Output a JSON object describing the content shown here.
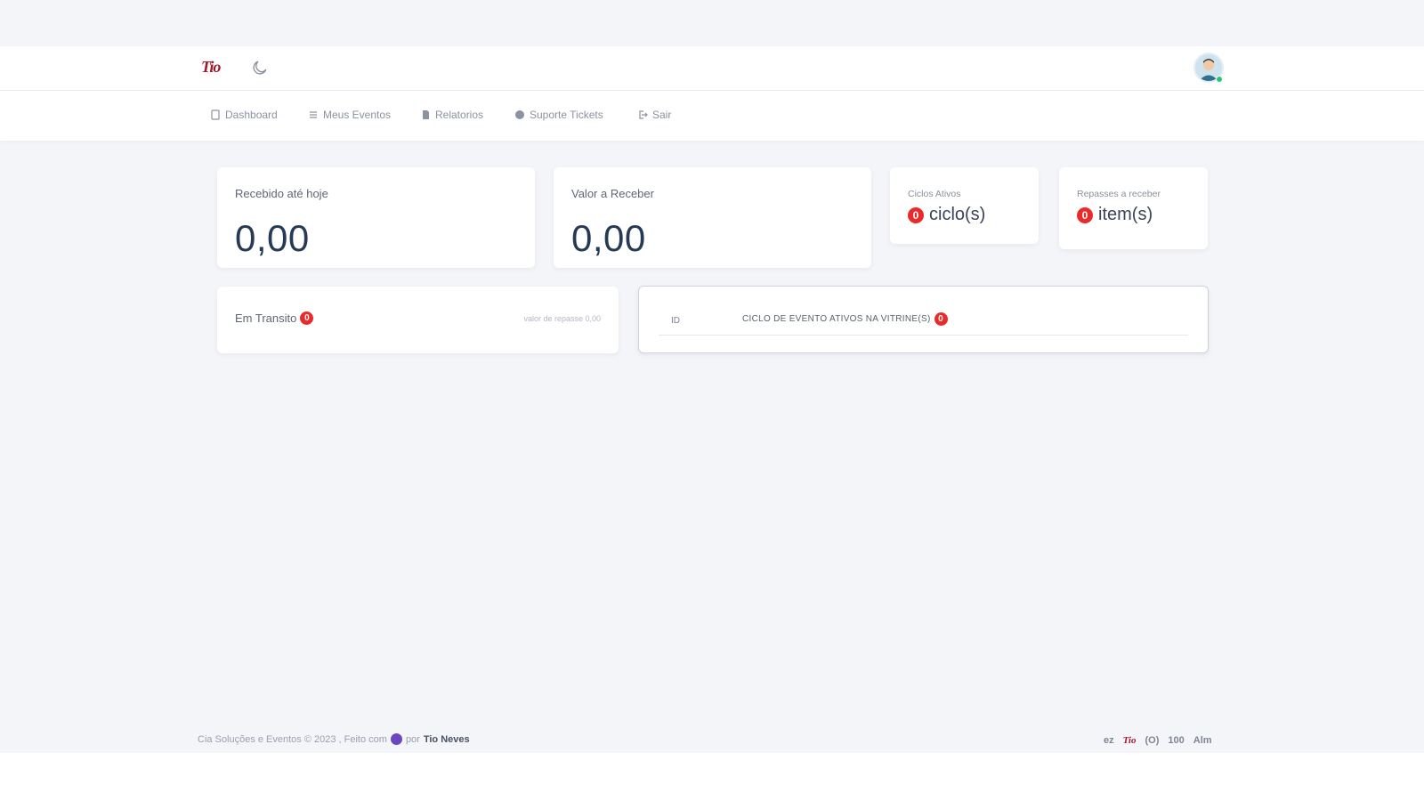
{
  "brand": {
    "logo_text": "Tio"
  },
  "header": {
    "theme_icon": "moon-icon",
    "avatar_icon": "user-avatar-icon"
  },
  "nav": {
    "items": [
      {
        "label": "Dashboard",
        "icon": "dashboard-icon"
      },
      {
        "label": "Meus Eventos",
        "icon": "list-icon"
      },
      {
        "label": "Relatorios",
        "icon": "report-icon"
      },
      {
        "label": "Suporte Tickets",
        "icon": "support-icon"
      },
      {
        "label": "Sair",
        "icon": "logout-icon"
      }
    ]
  },
  "cards": {
    "received": {
      "label": "Recebido até hoje",
      "value": "0,00"
    },
    "to_receive": {
      "label": "Valor a Receber",
      "value": "0,00"
    },
    "active_cycles": {
      "label": "Ciclos Ativos",
      "count": "0",
      "unit": "ciclo(s)"
    },
    "transfers": {
      "label": "Repasses a receber",
      "count": "0",
      "unit": "item(s)"
    },
    "in_transit": {
      "label": "Em Transito",
      "count": "0",
      "hint": "valor de repasse 0,00"
    },
    "showcase": {
      "col_id": "ID",
      "title": "CICLO DE EVENTO ATIVOS NA VITRINE(S)",
      "count": "0"
    }
  },
  "footer": {
    "text_prefix": "Cia Soluções e Eventos © 2023 , Feito com",
    "text_by": "por",
    "author": "Tio Neves",
    "logos": [
      "ez",
      "Tio",
      "(O)",
      "100",
      "Alm"
    ]
  },
  "colors": {
    "accent_red": "#ea2b2b",
    "brand_red": "#a3162b",
    "navy_value": "#273a55",
    "bg": "#f4f5f9"
  }
}
